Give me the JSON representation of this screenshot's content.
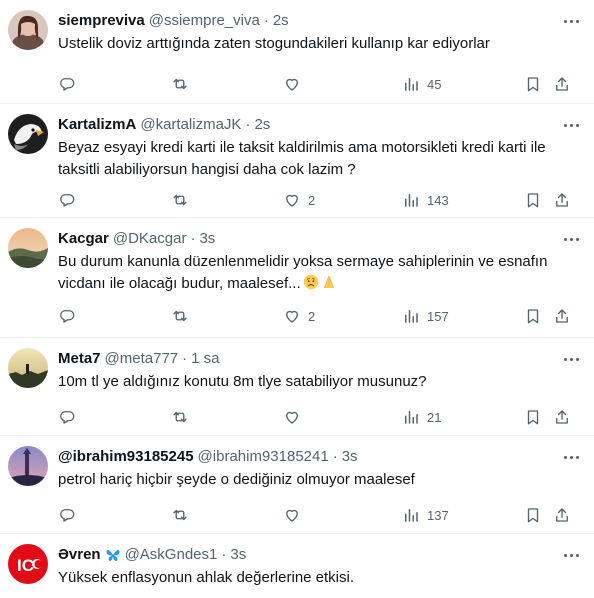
{
  "tweets": [
    {
      "name": "siempreviva",
      "handle": "@ssiempre_viva",
      "time": "2s",
      "text": "Ustelik doviz arttığında zaten stogundakileri kullanıp kar ediyorlar",
      "reply_count": "",
      "retweet_count": "",
      "like_count": "",
      "view_count": "45"
    },
    {
      "name": "KartalizmA",
      "handle": "@kartalizmaJK",
      "time": "2s",
      "text": "Beyaz esyayi kredi karti ile taksit kaldirilmis ama motorsikleti kredi karti ile taksitli alabiliyorsun hangisi daha cok lazim ?",
      "reply_count": "",
      "retweet_count": "",
      "like_count": "2",
      "view_count": "143"
    },
    {
      "name": "Kacgar",
      "handle": "@DKacgar",
      "time": "3s",
      "text": "Bu durum kanunla düzenlenmelidir yoksa sermaye sahiplerinin ve esnafın vicdanı ile olacağı budur, maalesef...",
      "reply_count": "",
      "retweet_count": "",
      "like_count": "2",
      "view_count": "157"
    },
    {
      "name": "Meta7",
      "handle": "@meta777",
      "time": "1 sa",
      "text": "10m tl ye aldığınız konutu 8m tlye satabiliyor musunuz?",
      "reply_count": "",
      "retweet_count": "",
      "like_count": "",
      "view_count": "21"
    },
    {
      "name": "@ibrahim93185245",
      "handle": "@ibrahim93185241",
      "time": "3s",
      "text": "petrol hariç hiçbir şeyde o dediğiniz olmuyor maalesef",
      "reply_count": "",
      "retweet_count": "",
      "like_count": "",
      "view_count": "137"
    },
    {
      "name": "Əvren",
      "handle": "@AskGndes1",
      "time": "3s",
      "text": "Yüksek enflasyonun ahlak değerlerine etkisi."
    }
  ],
  "dot": "·",
  "avatar_logo_text": "IC",
  "colors": {
    "text": "#0f1419",
    "secondary": "#536471",
    "divider": "#eff3f4",
    "butterfly": "#1d9bf0"
  },
  "icons": [
    "reply-icon",
    "retweet-icon",
    "like-icon",
    "views-icon",
    "bookmark-icon",
    "share-icon",
    "more-icon",
    "worried-face-emoji",
    "folded-hands-emoji",
    "butterfly-emoji"
  ]
}
